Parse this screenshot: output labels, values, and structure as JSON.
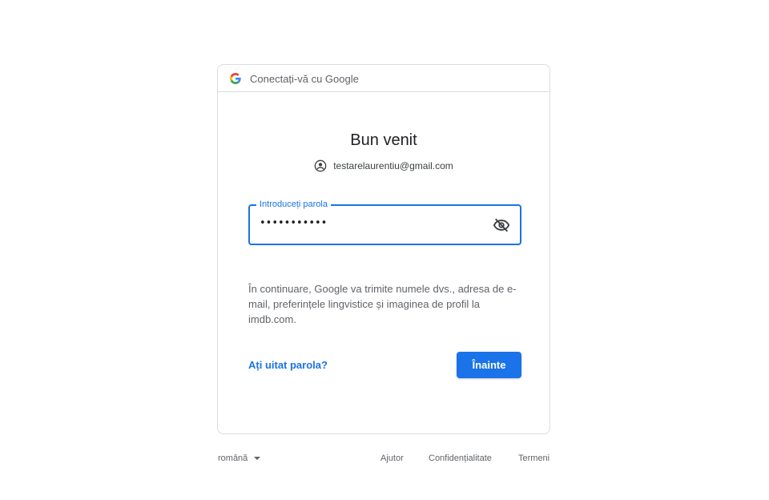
{
  "header": {
    "logo_icon": "google-g-icon",
    "title": "Conectați-vă cu Google"
  },
  "main": {
    "title": "Bun venit",
    "account_icon": "account-circle-icon",
    "email": "testarelaurentiu@gmail.com",
    "password_label": "Introduceți parola",
    "password_value": "•••••••••••",
    "toggle_icon": "eye-off-icon",
    "consent_text": "În continuare, Google va trimite numele dvs., adresa de e-mail, preferințele lingvistice și imaginea de profil la imdb.com.",
    "forgot_link": "Ați uitat parola?",
    "next_button": "Înainte"
  },
  "footer": {
    "language": "română",
    "help": "Ajutor",
    "privacy": "Confidențialitate",
    "terms": "Termeni"
  },
  "colors": {
    "accent": "#1a73e8",
    "border": "#dadce0",
    "text_secondary": "#5f6368"
  }
}
